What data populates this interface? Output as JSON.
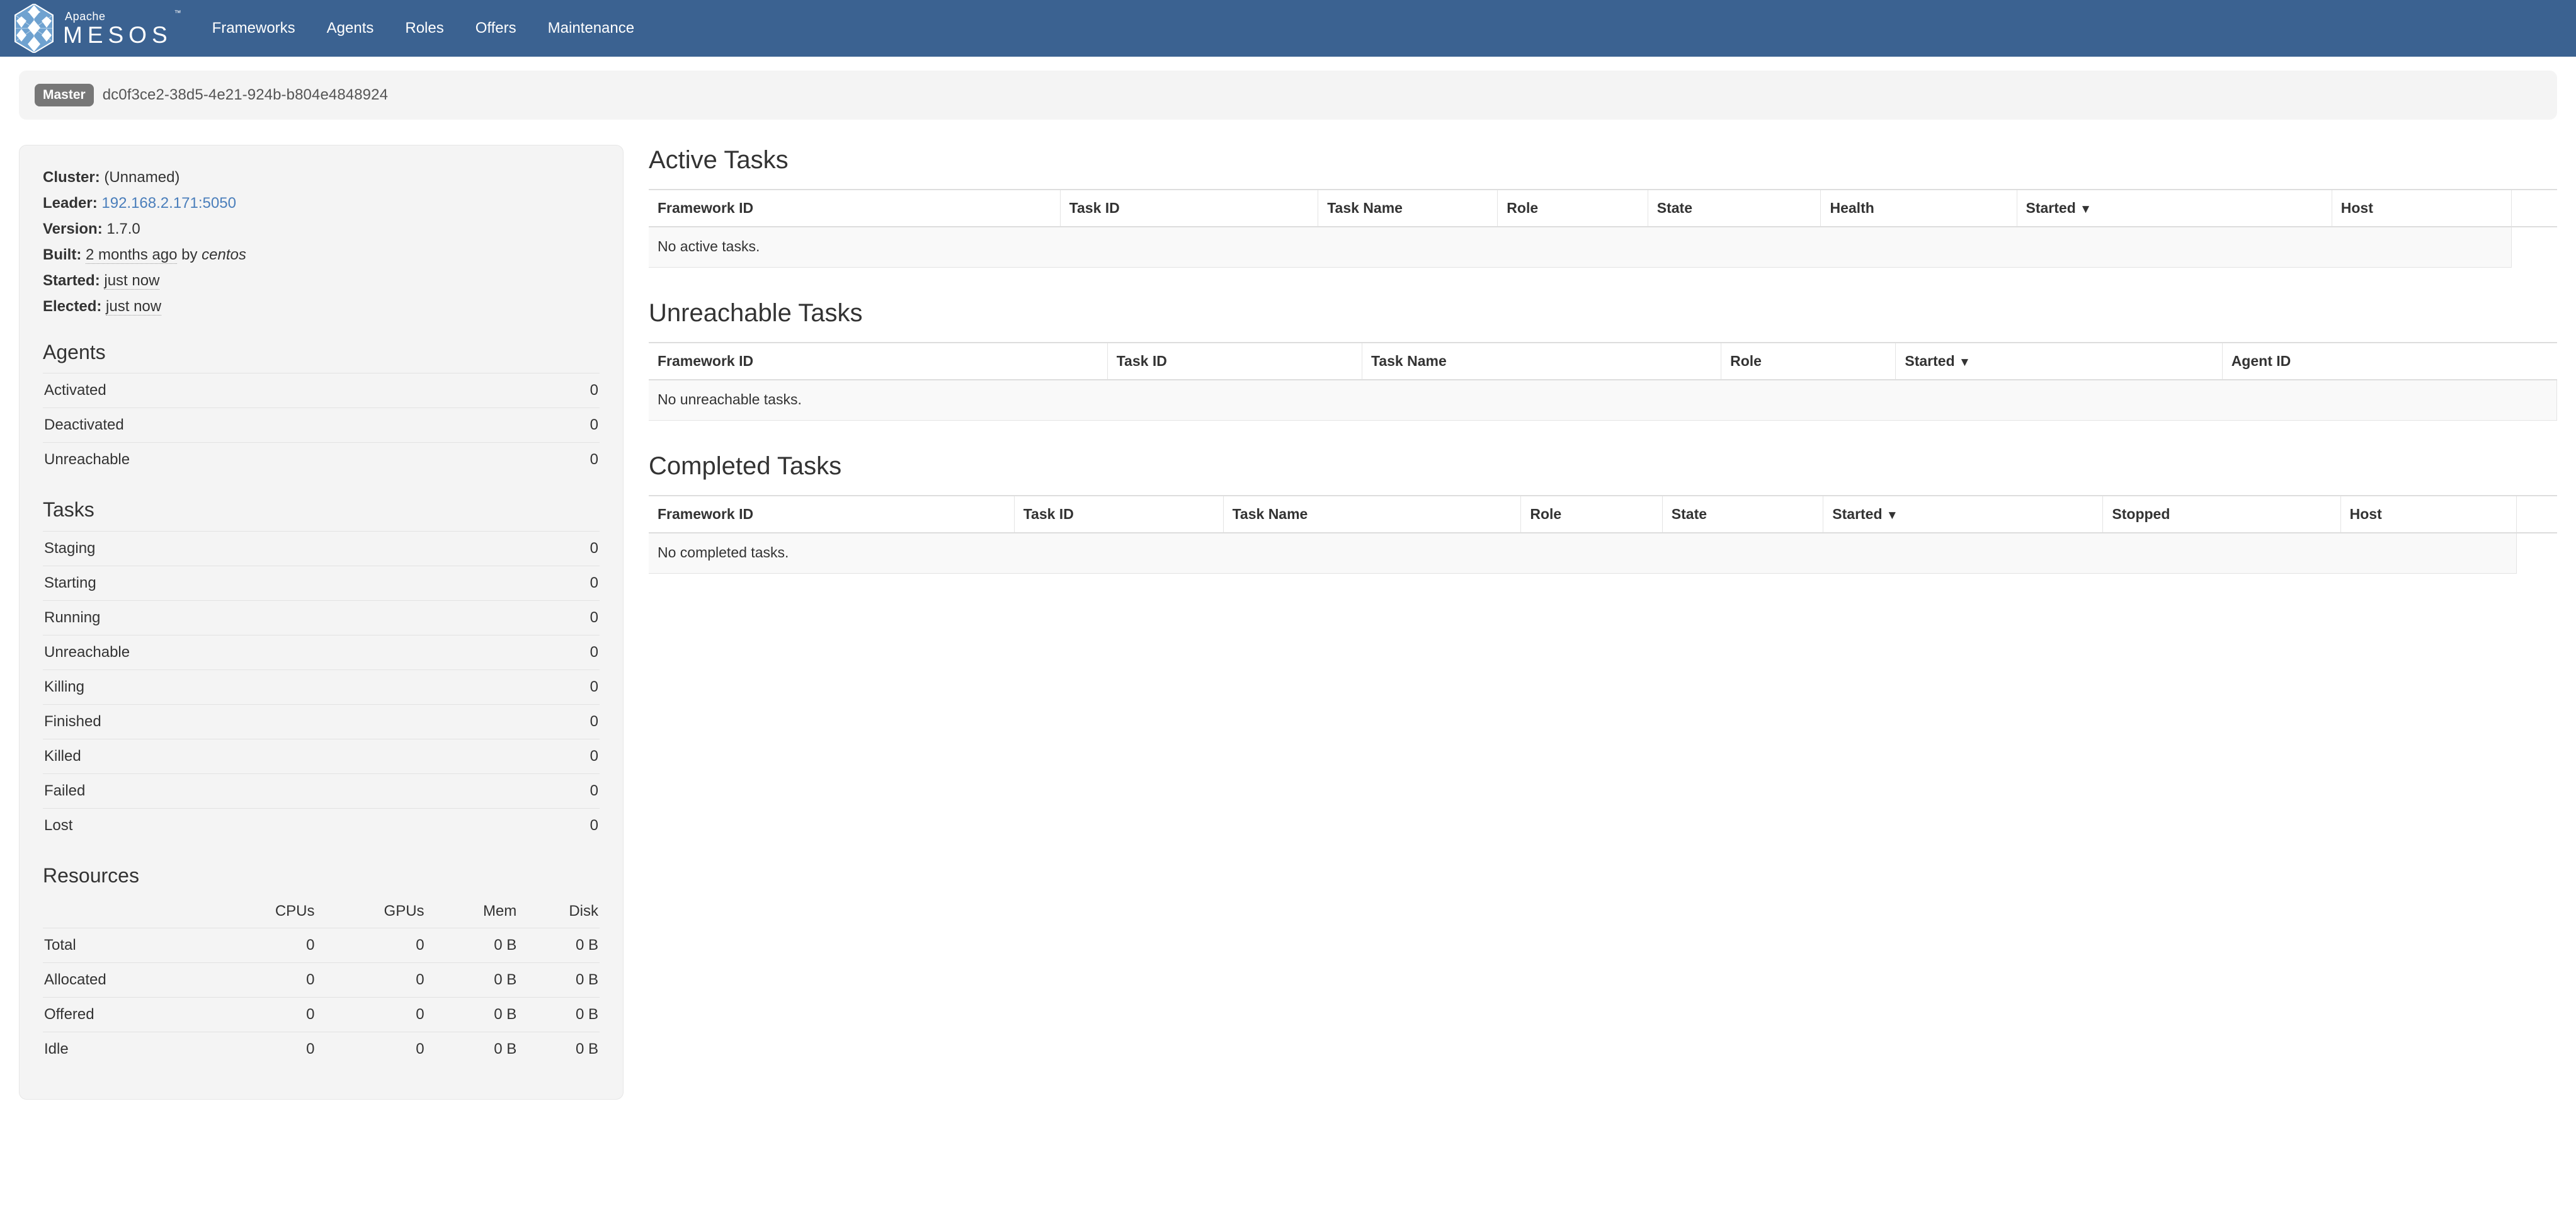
{
  "navbar": {
    "brand": {
      "apache": "Apache",
      "mesos": "MESOS",
      "tm": "™",
      "logo_icon": "mesos-hex-logo-icon"
    },
    "links": [
      {
        "label": "Frameworks",
        "name": "nav-link-frameworks"
      },
      {
        "label": "Agents",
        "name": "nav-link-agents"
      },
      {
        "label": "Roles",
        "name": "nav-link-roles"
      },
      {
        "label": "Offers",
        "name": "nav-link-offers"
      },
      {
        "label": "Maintenance",
        "name": "nav-link-maintenance"
      }
    ],
    "background_color": "#3b6291"
  },
  "master_bar": {
    "badge_label": "Master",
    "badge_color": "#777777",
    "id": "dc0f3ce2-38d5-4e21-924b-b804e4848924"
  },
  "sidebar": {
    "cluster_info": {
      "cluster_label": "Cluster:",
      "cluster_value": "(Unnamed)",
      "leader_label": "Leader:",
      "leader_value": "192.168.2.171:5050",
      "leader_link_color": "#4a7ebb",
      "version_label": "Version:",
      "version_value": "1.7.0",
      "built_label": "Built:",
      "built_value": "2 months ago",
      "built_by_word": "by",
      "built_by_user": "centos",
      "started_label": "Started:",
      "started_value": "just now",
      "elected_label": "Elected:",
      "elected_value": "just now"
    },
    "agents": {
      "title": "Agents",
      "rows": [
        {
          "label": "Activated",
          "value": "0"
        },
        {
          "label": "Deactivated",
          "value": "0"
        },
        {
          "label": "Unreachable",
          "value": "0"
        }
      ]
    },
    "tasks": {
      "title": "Tasks",
      "rows": [
        {
          "label": "Staging",
          "value": "0"
        },
        {
          "label": "Starting",
          "value": "0"
        },
        {
          "label": "Running",
          "value": "0"
        },
        {
          "label": "Unreachable",
          "value": "0"
        },
        {
          "label": "Killing",
          "value": "0"
        },
        {
          "label": "Finished",
          "value": "0"
        },
        {
          "label": "Killed",
          "value": "0"
        },
        {
          "label": "Failed",
          "value": "0"
        },
        {
          "label": "Lost",
          "value": "0"
        }
      ]
    },
    "resources": {
      "title": "Resources",
      "columns": [
        "",
        "CPUs",
        "GPUs",
        "Mem",
        "Disk"
      ],
      "rows": [
        {
          "label": "Total",
          "cpus": "0",
          "gpus": "0",
          "mem": "0 B",
          "disk": "0 B"
        },
        {
          "label": "Allocated",
          "cpus": "0",
          "gpus": "0",
          "mem": "0 B",
          "disk": "0 B"
        },
        {
          "label": "Offered",
          "cpus": "0",
          "gpus": "0",
          "mem": "0 B",
          "disk": "0 B"
        },
        {
          "label": "Idle",
          "cpus": "0",
          "gpus": "0",
          "mem": "0 B",
          "disk": "0 B"
        }
      ]
    }
  },
  "main": {
    "active_tasks": {
      "title": "Active Tasks",
      "columns": [
        "Framework ID",
        "Task ID",
        "Task Name",
        "Role",
        "State",
        "Health",
        "Started",
        "Host",
        ""
      ],
      "sorted_column": "Started",
      "sort_caret": "▼",
      "empty_message": "No active tasks.",
      "rows": []
    },
    "unreachable_tasks": {
      "title": "Unreachable Tasks",
      "columns": [
        "Framework ID",
        "Task ID",
        "Task Name",
        "Role",
        "Started",
        "Agent ID"
      ],
      "sorted_column": "Started",
      "sort_caret": "▼",
      "empty_message": "No unreachable tasks.",
      "rows": []
    },
    "completed_tasks": {
      "title": "Completed Tasks",
      "columns": [
        "Framework ID",
        "Task ID",
        "Task Name",
        "Role",
        "State",
        "Started",
        "Stopped",
        "Host",
        ""
      ],
      "sorted_column": "Started",
      "sort_caret": "▼",
      "empty_message": "No completed tasks.",
      "rows": []
    }
  }
}
